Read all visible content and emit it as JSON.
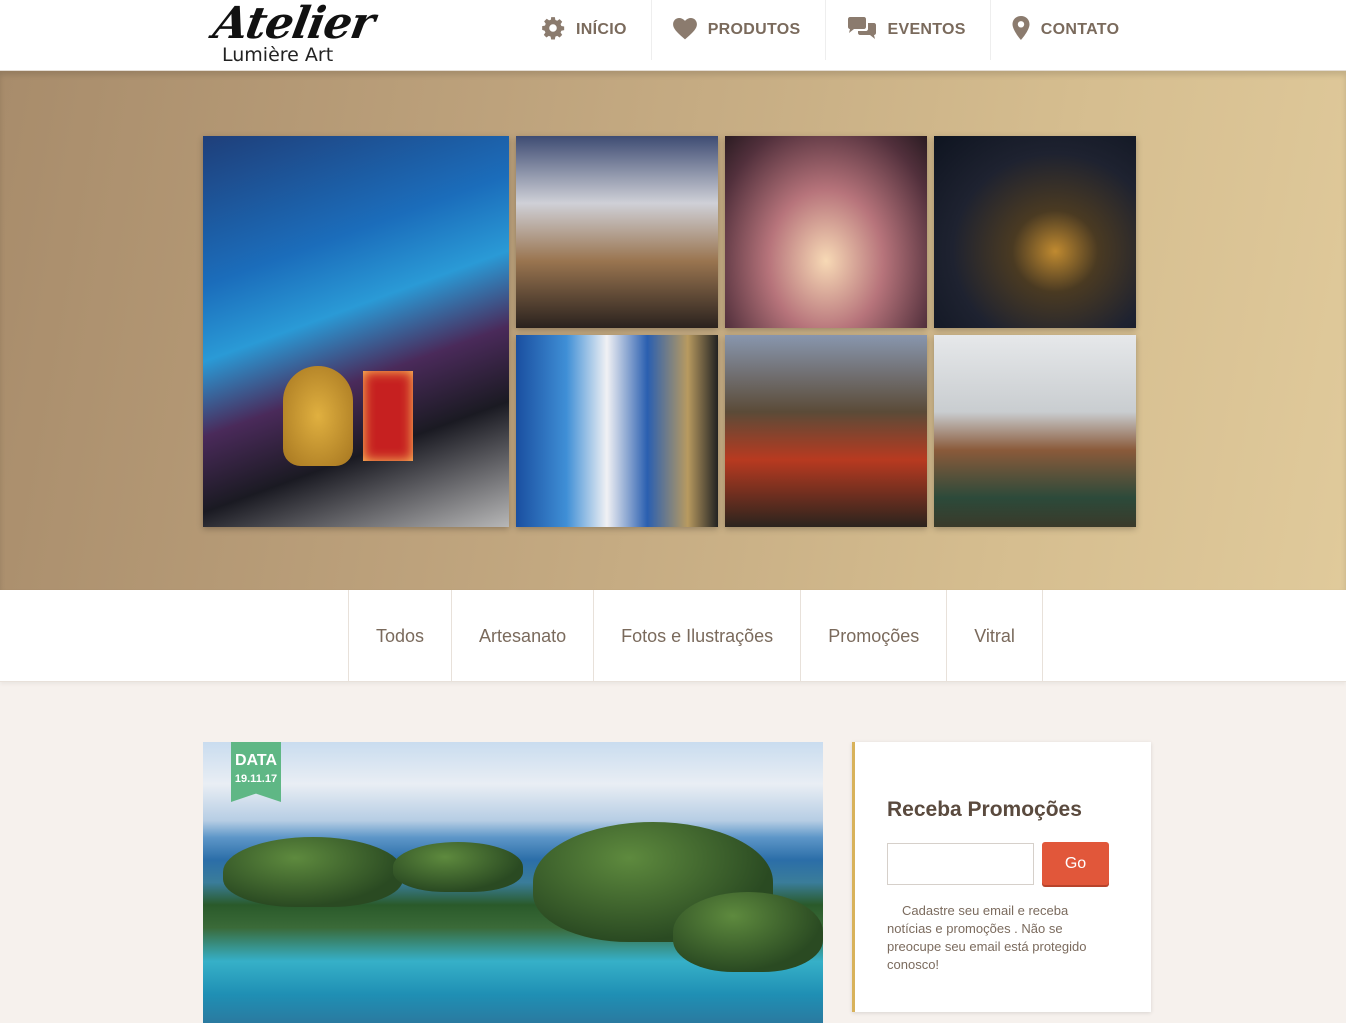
{
  "brand": {
    "script": "Atelier",
    "sub": "Lumière Art"
  },
  "nav": {
    "items": [
      {
        "label": "INÍCIO",
        "icon": "gear-icon"
      },
      {
        "label": "PRODUTOS",
        "icon": "heart-icon"
      },
      {
        "label": "EVENTOS",
        "icon": "chat-bubbles-icon"
      },
      {
        "label": "CONTATO",
        "icon": "map-pin-icon"
      }
    ]
  },
  "categories": [
    "Todos",
    "Artesanato",
    "Fotos e Ilustrações",
    "Promoções",
    "Vitral"
  ],
  "post": {
    "badge_label": "DATA",
    "badge_date": "19.11.17"
  },
  "newsletter": {
    "title": "Receba Promoções",
    "email_value": "",
    "button": "Go",
    "text": "Cadastre seu email e receba notícias e promoções . Não se preocupe seu email está protegido conosco!"
  },
  "colors": {
    "accent": "#e1573a",
    "badge": "#5fb785",
    "widget_border": "#d8b25a",
    "nav_text": "#7a6a5c"
  }
}
